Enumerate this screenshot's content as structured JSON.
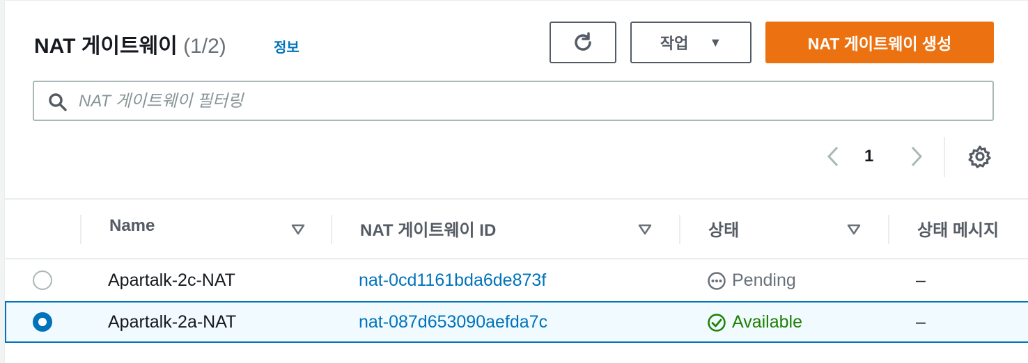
{
  "header": {
    "title": "NAT 게이트웨이",
    "count": "(1/2)",
    "info_link": "정보"
  },
  "toolbar": {
    "actions_label": "작업",
    "create_label": "NAT 게이트웨이 생성"
  },
  "search": {
    "placeholder": "NAT 게이트웨이 필터링"
  },
  "pagination": {
    "current_page": "1"
  },
  "table": {
    "columns": [
      "Name",
      "NAT 게이트웨이 ID",
      "상태",
      "상태 메시지"
    ],
    "rows": [
      {
        "selected": false,
        "name": "Apartalk-2c-NAT",
        "id": "nat-0cd1161bda6de873f",
        "state": "Pending",
        "message": "–"
      },
      {
        "selected": true,
        "name": "Apartalk-2a-NAT",
        "id": "nat-087d653090aefda7c",
        "state": "Available",
        "message": "–"
      }
    ]
  },
  "colors": {
    "primary": "#ec7211",
    "link": "#0073bb",
    "available": "#1d8102",
    "pending": "#687078"
  }
}
